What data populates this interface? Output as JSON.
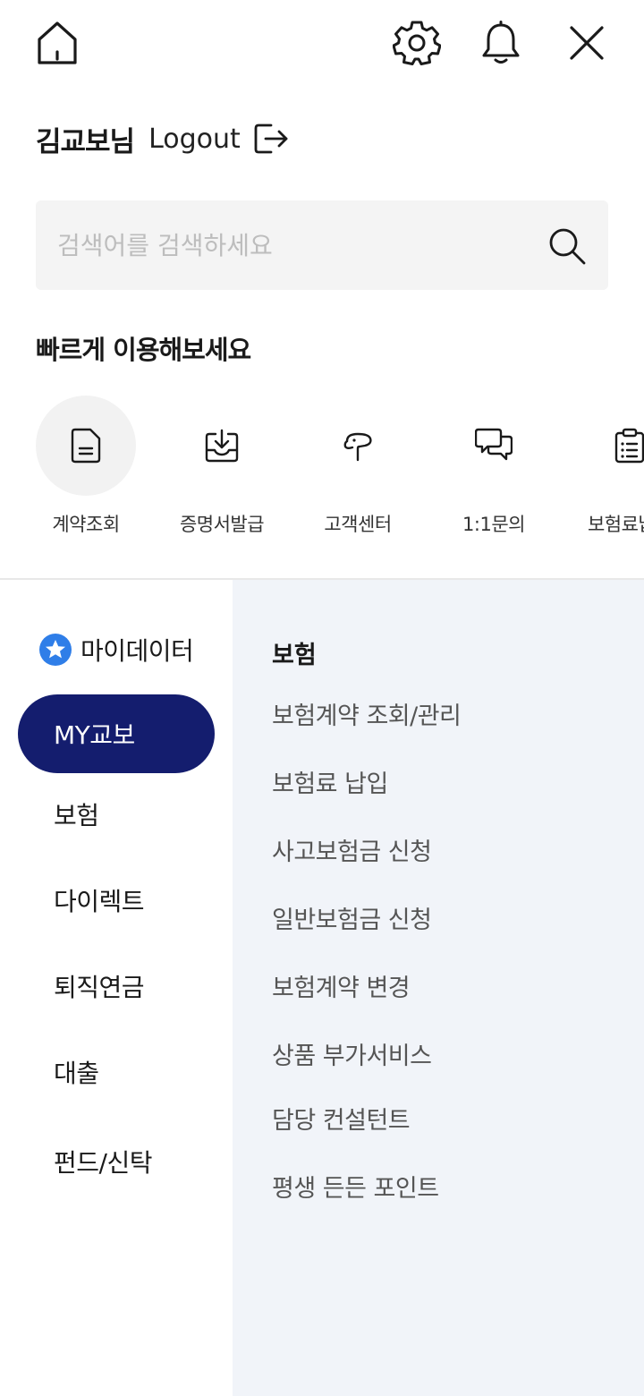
{
  "header": {
    "icons": [
      "home-icon",
      "gear-icon",
      "bell-icon",
      "close-icon"
    ]
  },
  "user": {
    "name": "김교보님",
    "logout_label": "Logout"
  },
  "search": {
    "placeholder": "검색어를 검색하세요",
    "value": ""
  },
  "quick": {
    "title": "빠르게 이용해보세요",
    "items": [
      {
        "label": "계약조회",
        "icon": "document-icon"
      },
      {
        "label": "증명서발급",
        "icon": "download-tray-icon"
      },
      {
        "label": "고객센터",
        "icon": "headset-icon"
      },
      {
        "label": "1:1문의",
        "icon": "chat-bubbles-icon"
      },
      {
        "label": "보험료납입",
        "icon": "clipboard-list-icon"
      }
    ]
  },
  "left_nav": {
    "mydata_label": "마이데이터",
    "items": [
      {
        "label": "MY교보",
        "active": true
      },
      {
        "label": "보험"
      },
      {
        "label": "다이렉트"
      },
      {
        "label": "퇴직연금"
      },
      {
        "label": "대출"
      },
      {
        "label": "펀드/신탁"
      }
    ]
  },
  "submenu": {
    "title": "보험",
    "items": [
      "보험계약 조회/관리",
      "보험료 납입",
      "사고보험금 신청",
      "일반보험금 신청",
      "보험계약 변경",
      "상품 부가서비스",
      "담당 컨설턴트",
      "평생 든든 포인트"
    ]
  },
  "colors": {
    "active_nav_bg": "#141d6e",
    "right_panel_bg": "#f1f4f9",
    "mydata_star": "#2f7ee8"
  }
}
